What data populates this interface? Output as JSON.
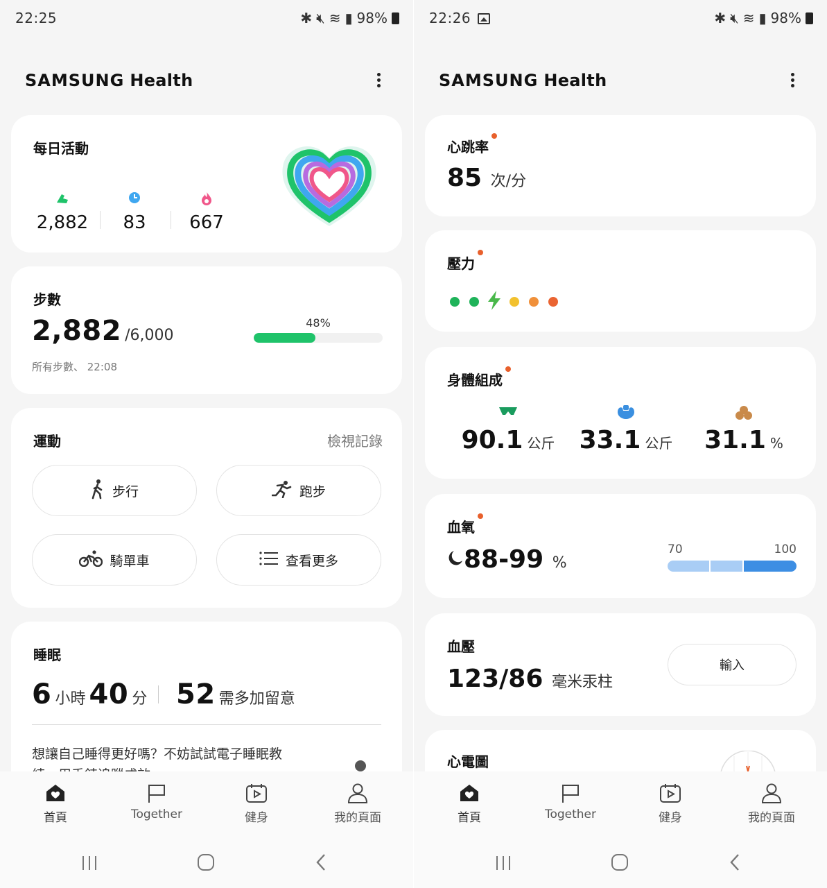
{
  "left": {
    "status": {
      "time": "22:25",
      "battery": "98%"
    },
    "app": {
      "brand": "SAMSUNG",
      "brand2": "Health"
    },
    "daily_activity": {
      "title": "每日活動",
      "steps": "2,882",
      "active_minutes": "83",
      "calories": "667",
      "colors": {
        "steps": "#1fc36a",
        "minutes": "#3fa7f0",
        "calories": "#f0578a"
      }
    },
    "steps": {
      "title": "步數",
      "count": "2,882",
      "goal": "/6,000",
      "percent_label": "48%",
      "progress": 0.48,
      "subtitle": "所有步數、 22:08"
    },
    "exercise": {
      "title": "運動",
      "view_records": "檢視記錄",
      "buttons": [
        "步行",
        "跑步",
        "騎單車",
        "查看更多"
      ]
    },
    "sleep": {
      "title": "睡眠",
      "hours": "6",
      "hours_unit": "小時",
      "minutes": "40",
      "minutes_unit": "分",
      "score": "52",
      "score_label": "需多加留意",
      "tip": "想讓自己睡得更好嗎？不妨試試電子睡眠教",
      "tip_line2": "練，用手錶追蹤成效"
    },
    "nav": [
      "首頁",
      "Together",
      "健身",
      "我的頁面"
    ]
  },
  "right": {
    "status": {
      "time": "22:26",
      "battery": "98%"
    },
    "app": {
      "brand": "SAMSUNG",
      "brand2": "Health"
    },
    "heart_rate": {
      "title": "心跳率",
      "value": "85",
      "unit": "次/分"
    },
    "stress": {
      "title": "壓力",
      "dot_colors": [
        "#1fb35a",
        "#1fb35a",
        "#49b84a",
        "#f2c12e",
        "#f0903a",
        "#ea6432"
      ]
    },
    "body_composition": {
      "title": "身體組成",
      "items": [
        {
          "value": "90.1",
          "unit": "公斤",
          "icon": "muscle-band-icon",
          "color": "#1a9c5e"
        },
        {
          "value": "33.1",
          "unit": "公斤",
          "icon": "muscle-arm-icon",
          "color": "#3a8fe0"
        },
        {
          "value": "31.1",
          "unit": "%",
          "icon": "fat-cells-icon",
          "color": "#c98a4a"
        }
      ]
    },
    "blood_oxygen": {
      "title": "血氧",
      "value": "88-99",
      "unit": "%",
      "scale_min": "70",
      "scale_max": "100",
      "range_start": 88,
      "range_end": 99
    },
    "blood_pressure": {
      "title": "血壓",
      "value": "123/86",
      "unit": "毫米汞柱",
      "input_label": "輸入"
    },
    "ecg": {
      "title": "心電圖"
    },
    "nav": [
      "首頁",
      "Together",
      "健身",
      "我的頁面"
    ]
  }
}
